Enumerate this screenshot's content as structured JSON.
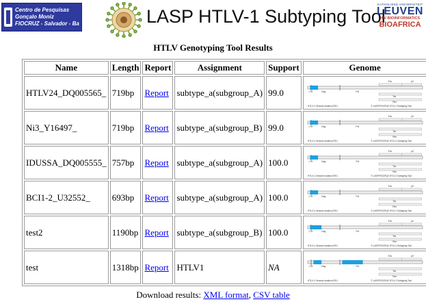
{
  "header": {
    "left_logo_lines": [
      "Centro de Pesquisas",
      "Gonçalo Moniz",
      "FIOCRUZ - Salvador - Ba"
    ],
    "title": "LASP HTLV-1 Subtyping Tool",
    "right_logo": {
      "university": "KATHOLIEKE UNIVERSITEIT",
      "name": "LEUVEN",
      "tagline": "HIV BIOINFORMATICS",
      "program": "BIOAFRICA"
    }
  },
  "page_title": "HTLV Genotyping Tool Results",
  "table": {
    "columns": [
      "Name",
      "Length",
      "Report",
      "Assignment",
      "Support",
      "Genome"
    ],
    "rows": [
      {
        "name": "HTLV24_DQ005565_",
        "length": "719bp",
        "report": "Report",
        "assignment": "subtype_a(subgroup_A)",
        "support": "99.0",
        "genome_segments": [
          [
            0.02,
            0.09
          ]
        ]
      },
      {
        "name": "Ni3_Y16497_",
        "length": "719bp",
        "report": "Report",
        "assignment": "subtype_a(subgroup_B)",
        "support": "99.0",
        "genome_segments": [
          [
            0.02,
            0.09
          ]
        ]
      },
      {
        "name": "IDUSSA_DQ005555_",
        "length": "757bp",
        "report": "Report",
        "assignment": "subtype_a(subgroup_A)",
        "support": "100.0",
        "genome_segments": [
          [
            0.02,
            0.09
          ]
        ]
      },
      {
        "name": "BCI1-2_U32552_",
        "length": "693bp",
        "report": "Report",
        "assignment": "subtype_a(subgroup_A)",
        "support": "100.0",
        "genome_segments": [
          [
            0.02,
            0.09
          ]
        ]
      },
      {
        "name": "test2",
        "length": "1190bp",
        "report": "Report",
        "assignment": "subtype_a(subgroup_B)",
        "support": "100.0",
        "genome_segments": [
          [
            0.02,
            0.12
          ]
        ]
      },
      {
        "name": "test",
        "length": "1318bp",
        "report": "Report",
        "assignment": "HTLV1",
        "support": "NA",
        "genome_segments": [
          [
            0.05,
            0.12
          ],
          [
            0.3,
            0.48
          ]
        ]
      }
    ],
    "genome_map": {
      "genes": [
        "LTR",
        "Gag",
        "Pol",
        "Env",
        "pX",
        "Tax",
        "Rex"
      ],
      "footer_left": "HTLV-1 Genome location ATK1",
      "footer_right": "© LASP/FIOCRUZ HTLV-1 Subtyping Tool",
      "highlight_color": "#1ea0e0"
    }
  },
  "download": {
    "label": "Download results:",
    "xml": "XML format",
    "csv": "CSV table"
  }
}
